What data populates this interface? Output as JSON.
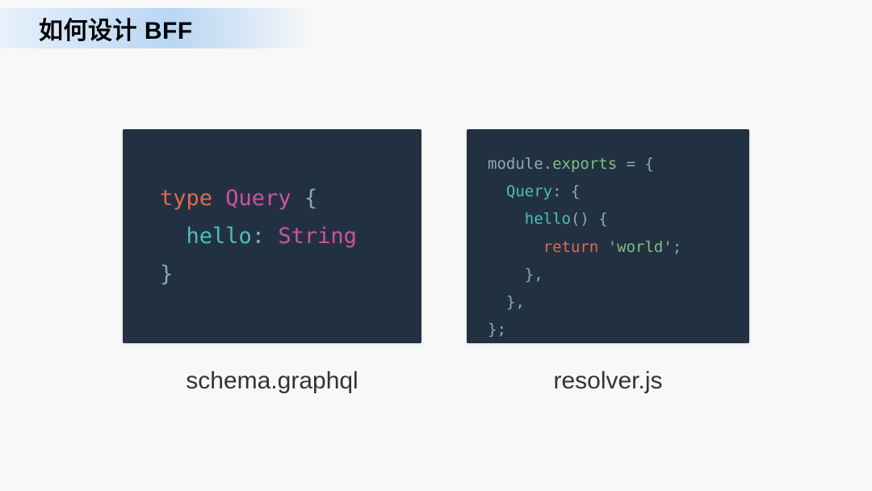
{
  "header": {
    "title": "如何设计 BFF"
  },
  "schema": {
    "caption": "schema.graphql",
    "tokens": {
      "kw_type": "type",
      "name_query": "Query",
      "brace_open": "{",
      "field_hello": "hello",
      "colon": ":",
      "type_string": "String",
      "brace_close": "}"
    }
  },
  "resolver": {
    "caption": "resolver.js",
    "tokens": {
      "module": "module",
      "dot": ".",
      "exports": "exports",
      "eq": " = ",
      "brace_open": "{",
      "query_key": "Query",
      "colon": ":",
      "hello_fn": "hello",
      "paren": "()",
      "kw_return": "return",
      "str_world": "'world'",
      "semi": ";",
      "brace_close": "}",
      "comma": ","
    }
  }
}
